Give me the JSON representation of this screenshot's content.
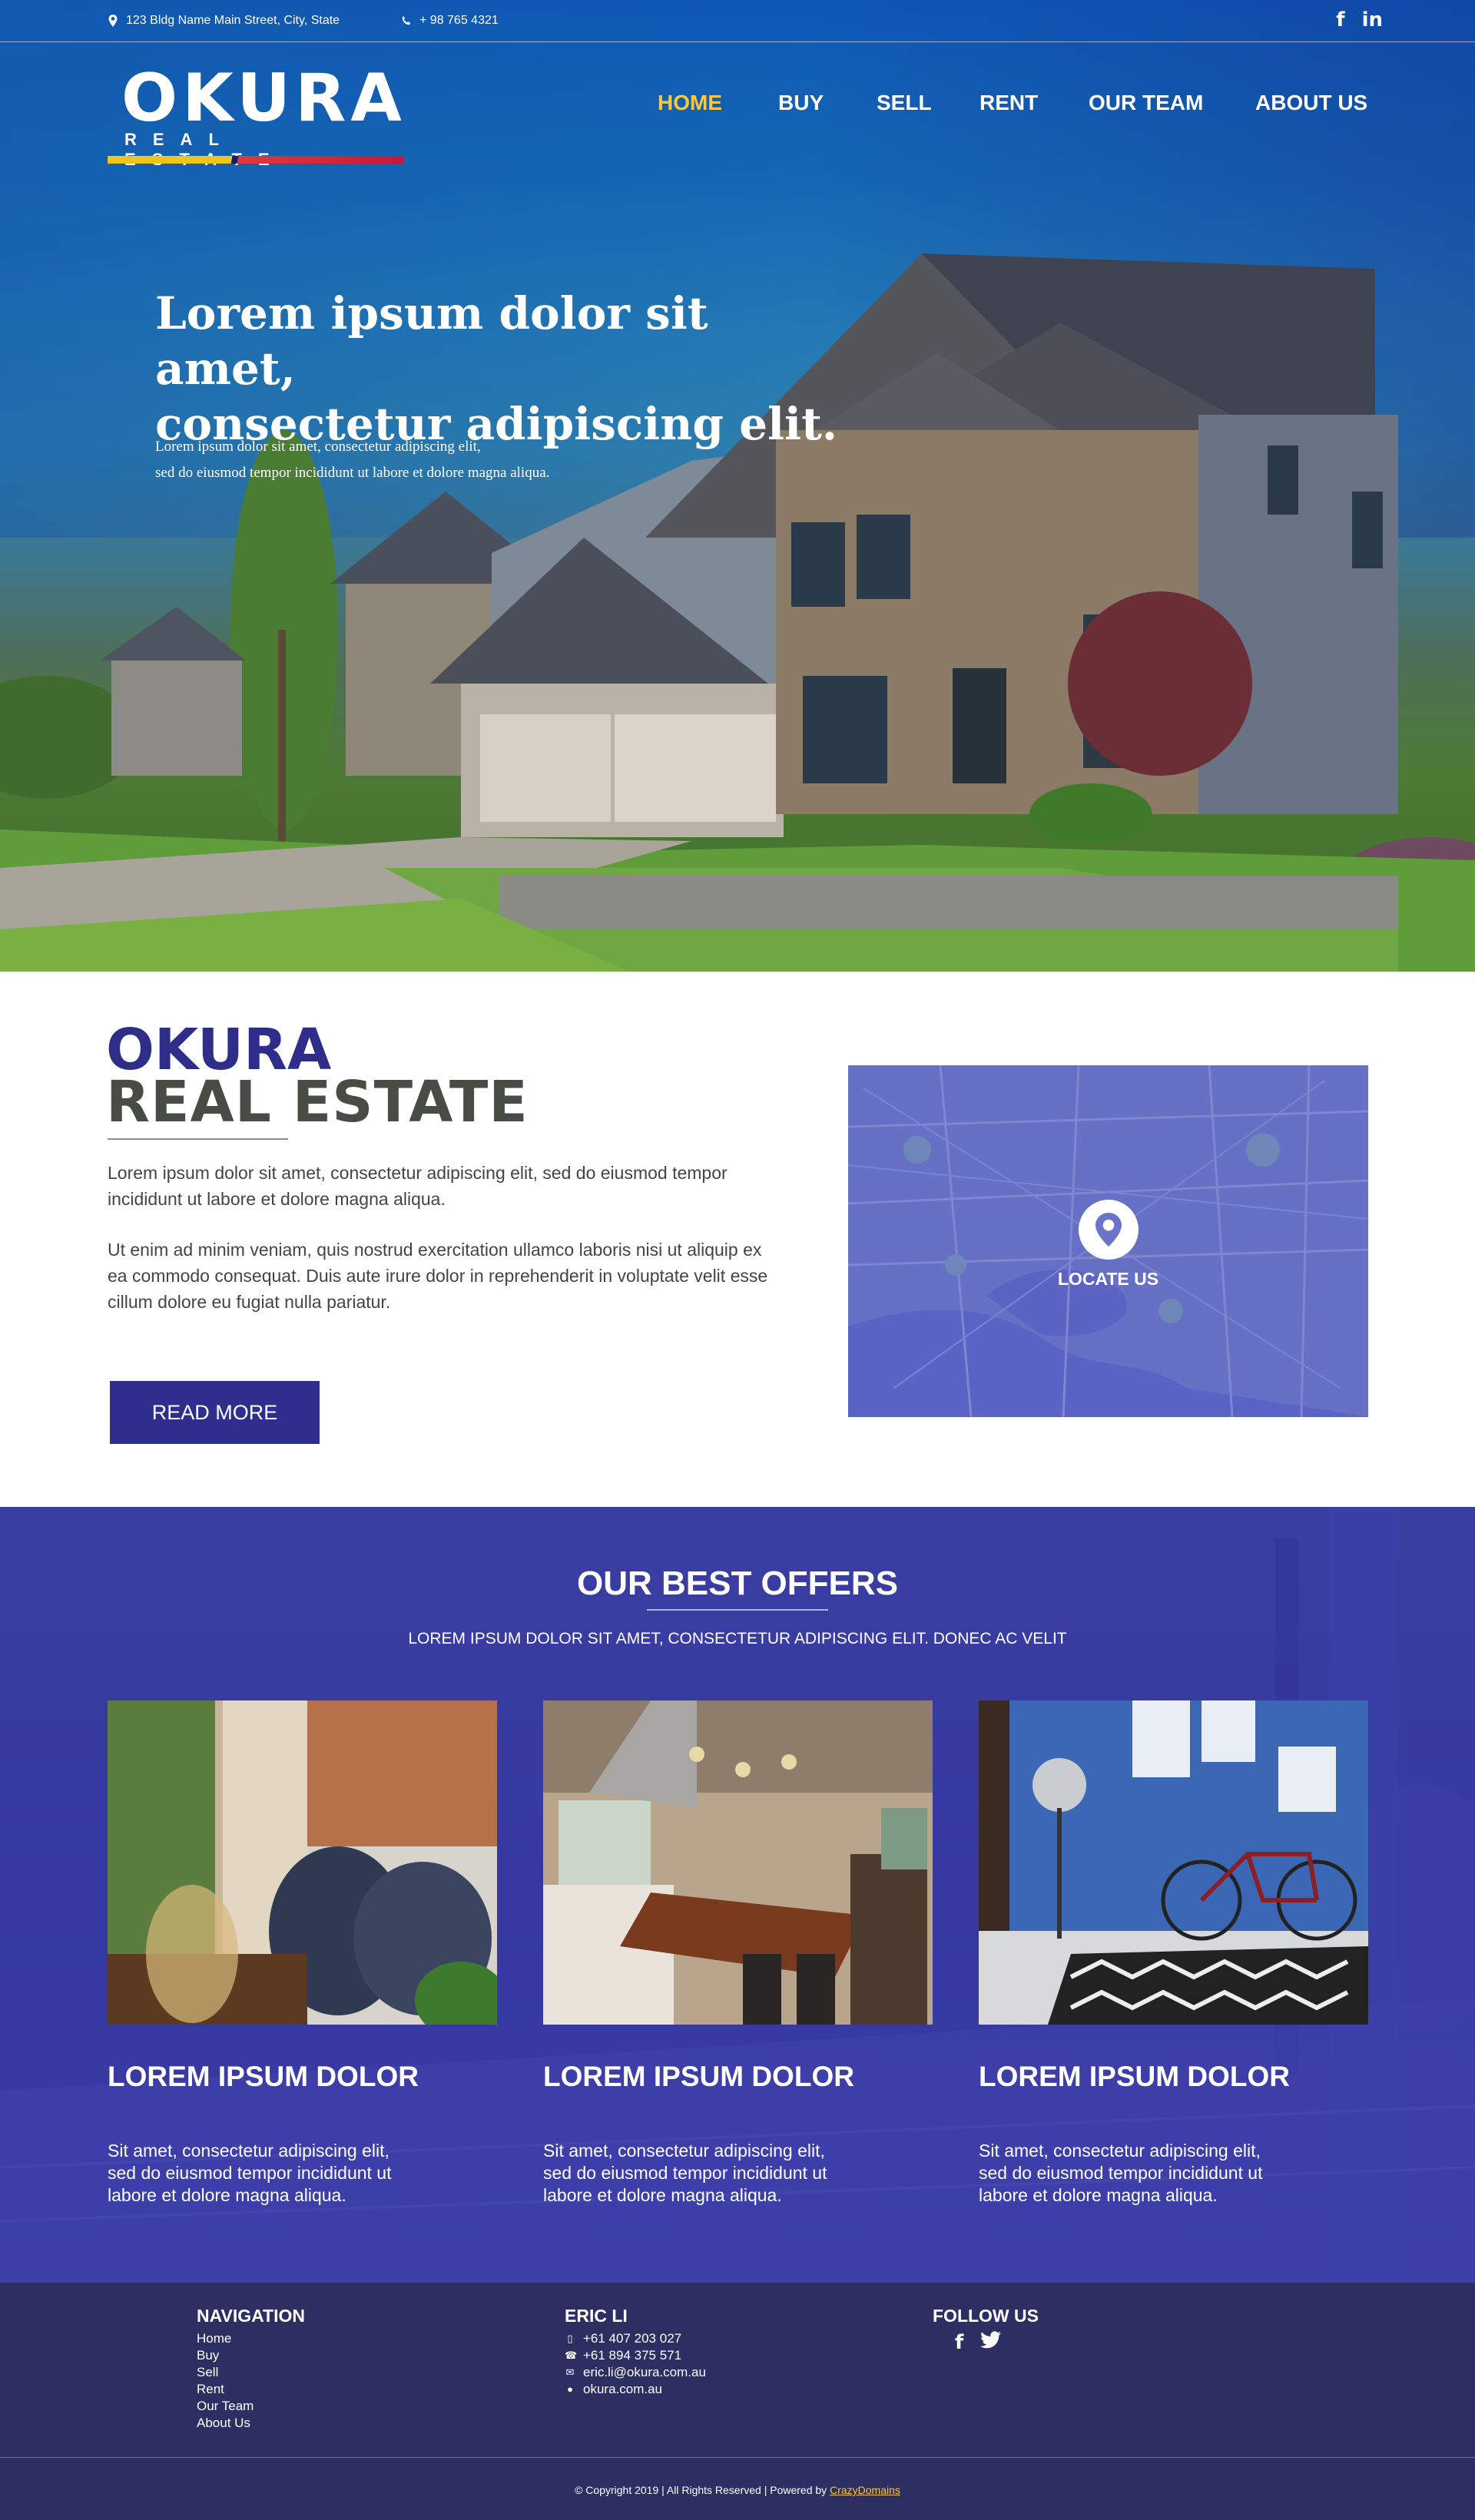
{
  "topbar": {
    "address": "123 Bldg Name Main Street, City, State",
    "phone": "+ 98 765 4321",
    "social": {
      "facebook": "f",
      "linkedin": "in"
    }
  },
  "logo": {
    "name": "OKURA",
    "tagline": "REAL ESTATE"
  },
  "nav": {
    "items": [
      {
        "label": "HOME",
        "active": true
      },
      {
        "label": "BUY"
      },
      {
        "label": "SELL"
      },
      {
        "label": "RENT"
      },
      {
        "label": "OUR TEAM"
      },
      {
        "label": "ABOUT US"
      }
    ]
  },
  "hero": {
    "title_line1": "Lorem ipsum dolor sit amet,",
    "title_line2": "consectetur adipiscing elit.",
    "sub_line1": "Lorem ipsum dolor sit amet, consectetur adipiscing elit,",
    "sub_line2": "sed do eiusmod tempor incididunt ut labore et dolore magna aliqua."
  },
  "about": {
    "brand_line1": "OKURA",
    "brand_line2": "REAL ESTATE",
    "paragraph1": "Lorem ipsum dolor sit amet, consectetur adipiscing elit, sed do eiusmod tempor incididunt ut labore et dolore magna aliqua.",
    "paragraph2": "Ut enim ad minim veniam, quis nostrud exercitation ullamco laboris nisi ut aliquip ex ea commodo consequat. Duis aute irure dolor in reprehenderit in voluptate velit esse cillum dolore eu fugiat nulla pariatur.",
    "read_more": "READ MORE",
    "map_label": "LOCATE US"
  },
  "offers": {
    "title": "OUR BEST OFFERS",
    "tagline": "LOREM IPSUM DOLOR SIT AMET, CONSECTETUR ADIPISCING ELIT. DONEC AC VELIT",
    "cards": [
      {
        "title": "LOREM IPSUM DOLOR",
        "text": "Sit amet, consectetur adipiscing elit, sed do eiusmod tempor incididunt ut labore et dolore magna aliqua."
      },
      {
        "title": "LOREM IPSUM DOLOR",
        "text": "Sit amet, consectetur adipiscing elit, sed do eiusmod tempor incididunt ut labore et dolore magna aliqua."
      },
      {
        "title": "LOREM IPSUM DOLOR",
        "text": "Sit amet, consectetur adipiscing elit, sed do eiusmod tempor incididunt ut labore et dolore magna aliqua."
      }
    ]
  },
  "footer": {
    "navigation_title": "NAVIGATION",
    "navigation_links": [
      "Home",
      "Buy",
      "Sell",
      "Rent",
      "Our Team",
      "About Us"
    ],
    "contact_title": "ERIC LI",
    "mobile": "+61 407 203 027",
    "phone": "+61 894 375 571",
    "email": "eric.li@okura.com.au",
    "website": "okura.com.au",
    "follow_title": "FOLLOW US",
    "social": {
      "facebook": "f",
      "twitter": "twitter"
    },
    "copyright": "© Copyright 2019  |  All Rights Reserved   |   Powered by ",
    "powered_link": "CrazyDomains"
  },
  "colors": {
    "brand_navy": "#2d2e8e",
    "accent_yellow": "#f6c843",
    "accent_red": "#d42a3a",
    "footer_bg": "#2d2e62",
    "offers_bg": "#3638a0"
  }
}
